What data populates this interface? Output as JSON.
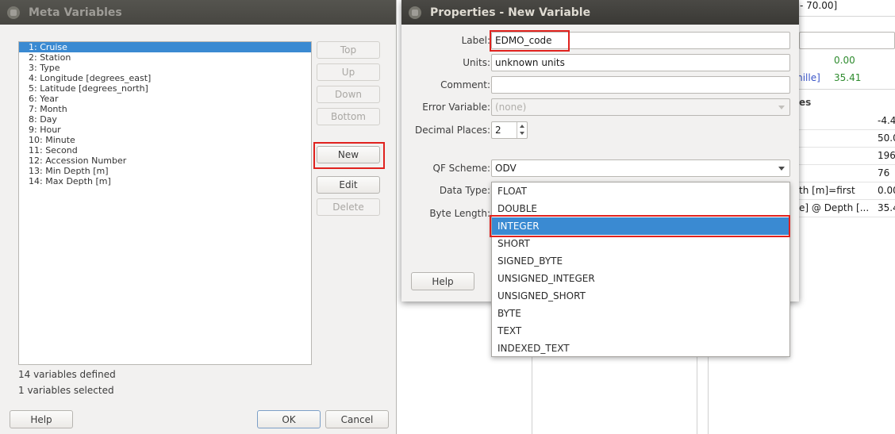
{
  "background": {
    "range_text": "- 70.00]",
    "value_green": "0.00",
    "unit_blue": "mille]",
    "value_2": "35.41",
    "section_heading": "es",
    "rows": [
      {
        "label": "",
        "value": "-4.4"
      },
      {
        "label": "",
        "value": "50.0"
      },
      {
        "label": "",
        "value": "196"
      },
      {
        "label": "",
        "value": "76"
      },
      {
        "label": "th [m]=first",
        "value": "0.00"
      },
      {
        "label": "e] @ Depth [...",
        "value": "35.4"
      }
    ]
  },
  "meta_dialog": {
    "title": "Meta Variables",
    "variables": [
      "1: Cruise",
      "2: Station",
      "3: Type",
      "4: Longitude [degrees_east]",
      "5: Latitude [degrees_north]",
      "6: Year",
      "7: Month",
      "8: Day",
      "9: Hour",
      "10: Minute",
      "11: Second",
      "12: Accession Number",
      "13: Min Depth [m]",
      "14: Max Depth [m]"
    ],
    "buttons": {
      "top": "Top",
      "up": "Up",
      "down": "Down",
      "bottom": "Bottom",
      "new": "New",
      "edit": "Edit",
      "delete": "Delete"
    },
    "status_defined": "14 variables defined",
    "status_selected": "1 variables selected",
    "help": "Help",
    "ok": "OK",
    "cancel": "Cancel"
  },
  "properties_dialog": {
    "title": "Properties - New Variable",
    "label_label": "Label:",
    "label_value": "EDMO_code",
    "units_label": "Units:",
    "units_value": "unknown units",
    "comment_label": "Comment:",
    "comment_value": "",
    "error_label": "Error Variable:",
    "error_value": "(none)",
    "decimal_label": "Decimal Places:",
    "decimal_value": "2",
    "qf_label": "QF Scheme:",
    "qf_value": "ODV",
    "datatype_label": "Data Type:",
    "bytelength_label": "Byte Length:",
    "help": "Help",
    "datatype_options": [
      "FLOAT",
      "DOUBLE",
      "INTEGER",
      "SHORT",
      "SIGNED_BYTE",
      "UNSIGNED_INTEGER",
      "UNSIGNED_SHORT",
      "BYTE",
      "TEXT",
      "INDEXED_TEXT"
    ],
    "datatype_selected": "INTEGER"
  },
  "colors": {
    "selection": "#3a8ad2",
    "highlight_box": "#e0221e",
    "titlebar": "#3a3935"
  }
}
